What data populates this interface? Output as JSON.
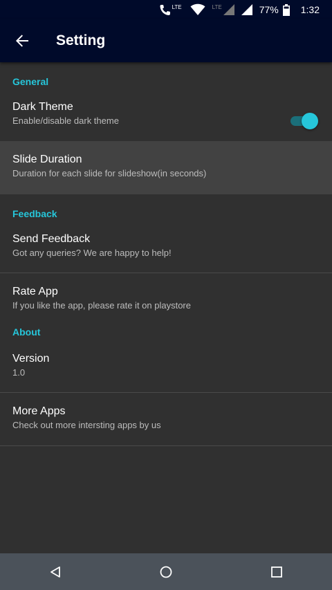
{
  "status_bar": {
    "lte1": "LTE",
    "lte2": "LTE",
    "battery": "77%",
    "time": "1:32"
  },
  "toolbar": {
    "title": "Setting",
    "back_icon": "arrow-back-icon"
  },
  "sections": {
    "general": {
      "header": "General",
      "dark_theme": {
        "title": "Dark Theme",
        "summary": "Enable/disable dark theme",
        "enabled": true
      },
      "slide_duration": {
        "title": "Slide Duration",
        "summary": "Duration for each slide for slideshow(in seconds)"
      }
    },
    "feedback": {
      "header": "Feedback",
      "send_feedback": {
        "title": "Send Feedback",
        "summary": "Got any queries? We are happy to help!"
      },
      "rate_app": {
        "title": "Rate App",
        "summary": "If you like the app, please rate it on playstore"
      }
    },
    "about": {
      "header": "About",
      "version": {
        "title": "Version",
        "summary": "1.0"
      },
      "more_apps": {
        "title": "More Apps",
        "summary": "Check out more intersting apps by us"
      }
    }
  },
  "colors": {
    "accent": "#26c6da",
    "toolbar_bg": "#000a2a",
    "background": "#303030",
    "nav_bar": "#4b525a"
  }
}
